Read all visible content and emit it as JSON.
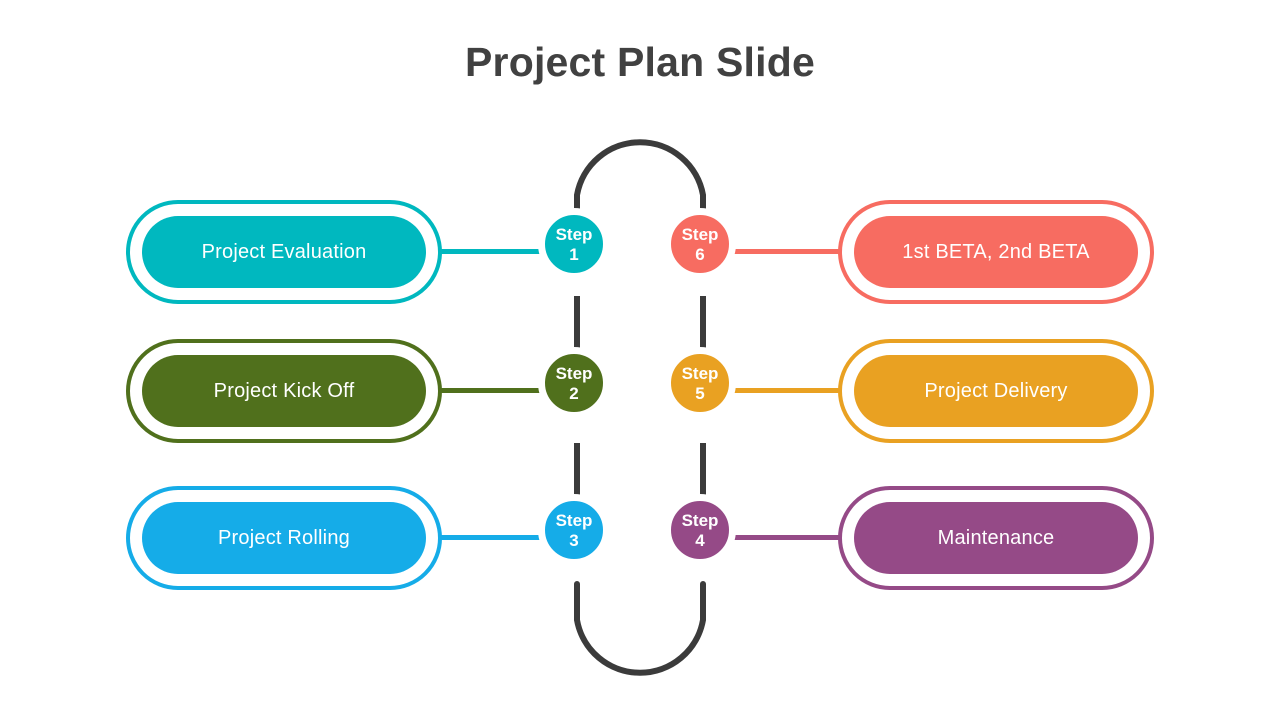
{
  "slide": {
    "title": "Project Plan Slide",
    "background_color": "#ffffff",
    "title_color": "#414141",
    "track_color": "#3b3b3b"
  },
  "rows": [
    {
      "step_word": "Step",
      "left": {
        "label": "Project Evaluation",
        "step_number": "1",
        "color": "#00b8bf"
      },
      "right": {
        "label": "1st BETA, 2nd BETA",
        "step_number": "6",
        "color": "#f76c61"
      }
    },
    {
      "step_word": "Step",
      "left": {
        "label": "Project Kick Off",
        "step_number": "2",
        "color": "#50701c"
      },
      "right": {
        "label": "Project Delivery",
        "step_number": "5",
        "color": "#e9a122"
      }
    },
    {
      "step_word": "Step",
      "left": {
        "label": "Project Rolling",
        "step_number": "3",
        "color": "#15ace8"
      },
      "right": {
        "label": "Maintenance",
        "step_number": "4",
        "color": "#954a87"
      }
    }
  ]
}
